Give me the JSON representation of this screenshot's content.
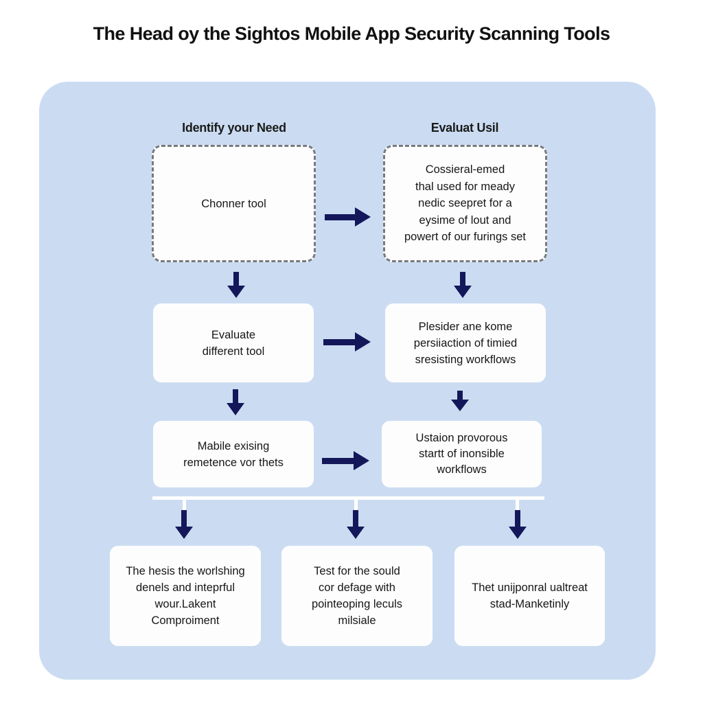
{
  "title": "The Head oy the Sightos Mobile App Security Scanning Tools",
  "colors": {
    "panel": "#cbdcf2",
    "box": "#fdfdfe",
    "arrow": "#14185a",
    "dashed_border": "#767a80"
  },
  "columns": {
    "left_heading": "Identify your Need",
    "right_heading": "Evaluat Usil"
  },
  "left_column": [
    {
      "text": "Chonner tool",
      "style": "dashed"
    },
    {
      "text": "Evaluate\ndifferent tool",
      "style": "solid"
    },
    {
      "text": "Mabile exising\nremetence vor thets",
      "style": "solid"
    }
  ],
  "right_column": [
    {
      "text": "Cossieral-emed\nthal used for meady\nnedic seepret for a\neysime of lout and\npowert of our furings set",
      "style": "dashed"
    },
    {
      "text": "Plesider ane kome\npersiiaction of timied\nsresisting workflows",
      "style": "solid"
    },
    {
      "text": "Ustaion provorous\nstartt of inonsible\nworkflows",
      "style": "solid"
    }
  ],
  "bottom_row": [
    {
      "text": "The hesis the worlshing\ndenels and inteprful\nwour.Lakent\nComproiment"
    },
    {
      "text": "Test for the sould\ncor defage with\npointeoping leculs\nmilsiale"
    },
    {
      "text": "Thet unijponral ualtreat\nstad-Manketinly"
    }
  ],
  "icons": {
    "right_arrow": "arrow-right-icon",
    "down_arrow": "arrow-down-icon"
  }
}
